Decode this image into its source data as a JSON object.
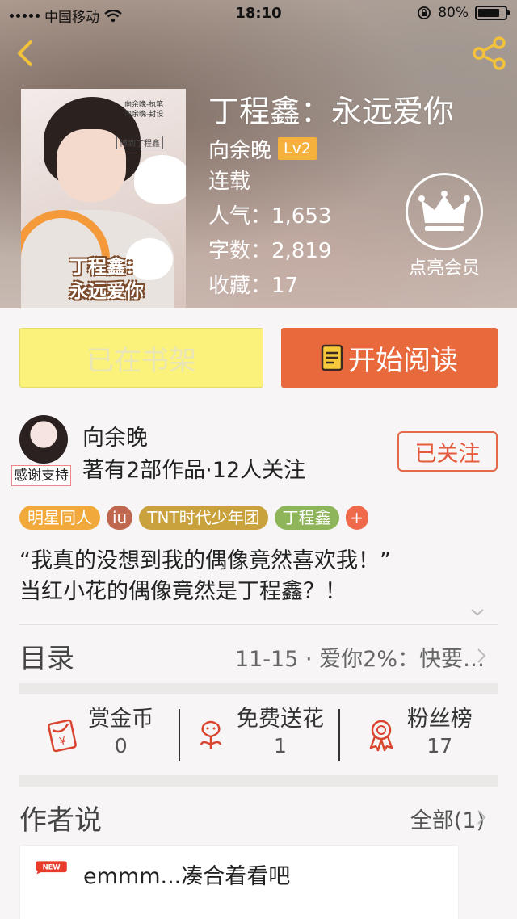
{
  "status_bar": {
    "carrier": "中国移动",
    "time": "18:10",
    "battery": "80%"
  },
  "book": {
    "title": "丁程鑫：永远爱你",
    "author": "向余晚",
    "level": "Lv2",
    "status": "连载",
    "popularity": "人气：1,653",
    "word_count": "字数：2,819",
    "favorites": "收藏：17",
    "vip_label": "点亮会员",
    "cover": {
      "title_line1": "丁程鑫：",
      "title_line2": "永远爱你",
      "credit_line1": "向余晚-执笔",
      "credit_line2": "向余晚-封设",
      "tag": "傅到丁程鑫"
    }
  },
  "actions": {
    "shelf_label": "已在书架",
    "read_label": "开始阅读"
  },
  "author_row": {
    "name": "向余晚",
    "stats": "著有2部作品·12人关注",
    "thanks_badge": "感谢支持",
    "follow_label": "已关注"
  },
  "tags": [
    {
      "label": "明星同人",
      "color": "#f2a93b"
    },
    {
      "label": "iu",
      "color": "#c0674f"
    },
    {
      "label": "TNT时代少年团",
      "color": "#c9a23e"
    },
    {
      "label": "丁程鑫",
      "color": "#8fb55a"
    },
    {
      "label": "+",
      "color": "#ee6a4a"
    }
  ],
  "description": {
    "line1": "“我真的没想到我的偶像竟然喜欢我！”",
    "line2": "当红小花的偶像竟然是丁程鑫？！"
  },
  "toc": {
    "label": "目录",
    "latest": "11-15 · 爱你2%：快要…"
  },
  "stats": [
    {
      "label": "赏金币",
      "value": "0",
      "icon": "red-envelope-icon"
    },
    {
      "label": "免费送花",
      "value": "1",
      "icon": "flower-icon"
    },
    {
      "label": "粉丝榜",
      "value": "17",
      "icon": "medal-icon"
    }
  ],
  "author_says": {
    "title": "作者说",
    "all_label": "全部(1)",
    "new_badge": "NEW",
    "first_post": "emmm...凑合着看吧"
  },
  "colors": {
    "accent_orange": "#e8693c",
    "shelf_yellow": "#fbf27b",
    "level_orange": "#f6b13d"
  }
}
